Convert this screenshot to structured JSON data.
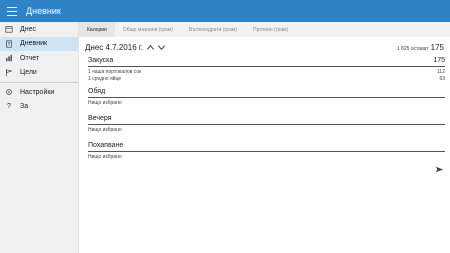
{
  "app": {
    "title": "Дневник"
  },
  "sidebar": {
    "items": [
      {
        "label": "Днес",
        "icon": "calendar-icon"
      },
      {
        "label": "Дневник",
        "icon": "journal-icon"
      },
      {
        "label": "Отчет",
        "icon": "chart-icon"
      },
      {
        "label": "Цели",
        "icon": "flag-icon"
      }
    ],
    "footer": [
      {
        "label": "Настройки",
        "icon": "gear-icon"
      },
      {
        "label": "За",
        "icon": "question-icon"
      }
    ]
  },
  "tabs": [
    {
      "label": "Калории"
    },
    {
      "label": "Общо мазнини (грам)"
    },
    {
      "label": "Въглехидрати (грам)"
    },
    {
      "label": "Протеин (грам)"
    }
  ],
  "day": {
    "date_label": "Днес 4.7.2016 г.",
    "remaining_label": "1 825 остават",
    "remaining_value": "175"
  },
  "meals": [
    {
      "name": "Закуска",
      "total": "175",
      "items": [
        {
          "name": "1 чаша портокалов сок",
          "value": "112"
        },
        {
          "name": "1 средно яйце",
          "value": "63"
        }
      ]
    },
    {
      "name": "Обяд",
      "total": "",
      "items": [
        {
          "name": "Нищо избрано",
          "value": ""
        }
      ]
    },
    {
      "name": "Вечеря",
      "total": "",
      "items": [
        {
          "name": "Нищо избрано",
          "value": ""
        }
      ]
    },
    {
      "name": "Похапване",
      "total": "",
      "items": [
        {
          "name": "Нищо избрано",
          "value": ""
        }
      ]
    }
  ],
  "colors": {
    "accent": "#2f83c5",
    "selected": "#cfe3f2"
  }
}
